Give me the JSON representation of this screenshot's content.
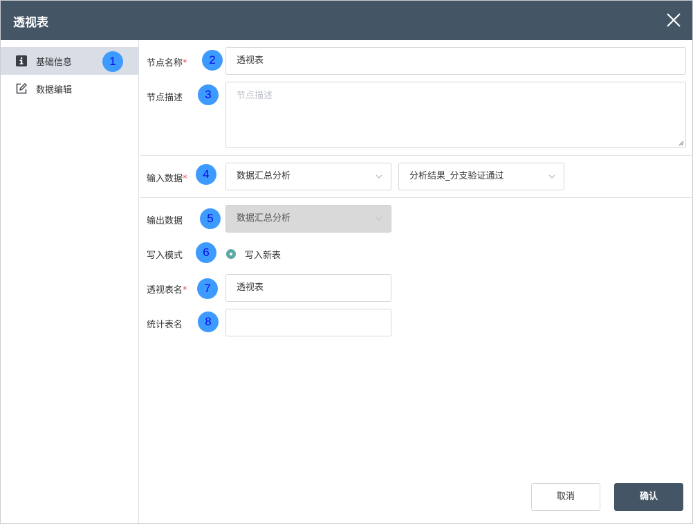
{
  "dialog": {
    "title": "透视表",
    "close_icon": "close-icon"
  },
  "sidebar": {
    "items": [
      {
        "label": "基础信息",
        "icon": "info-icon",
        "active": true
      },
      {
        "label": "数据编辑",
        "icon": "edit-icon",
        "active": false
      }
    ]
  },
  "badges": [
    "1",
    "2",
    "3",
    "4",
    "5",
    "6",
    "7",
    "8"
  ],
  "form": {
    "node_name": {
      "label": "节点名称",
      "required": "*",
      "value": "透视表"
    },
    "node_desc": {
      "label": "节点描述",
      "placeholder": "节点描述"
    },
    "input_data": {
      "label": "输入数据",
      "required": "*",
      "select1": "数据汇总分析",
      "select2": "分析结果_分支验证通过"
    },
    "output_data": {
      "label": "输出数据",
      "select": "数据汇总分析"
    },
    "write_mode": {
      "label": "写入模式",
      "option": "写入新表"
    },
    "pivot_name": {
      "label": "透视表名",
      "required": "*",
      "value": "透视表"
    },
    "stat_name": {
      "label": "统计表名",
      "value": ""
    }
  },
  "buttons": {
    "cancel": "取消",
    "confirm": "确认"
  },
  "colors": {
    "header": "#445565",
    "badge": "#3d9bff",
    "radio": "#5aa9a3",
    "required": "#e34b4b"
  }
}
